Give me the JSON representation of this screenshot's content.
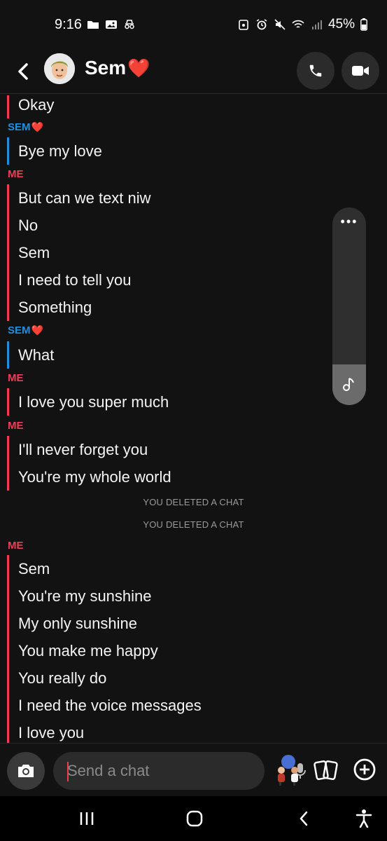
{
  "status_bar": {
    "time": "9:16",
    "battery": "45%",
    "left_icons": [
      "folder-icon",
      "image-icon",
      "incognito-icon"
    ],
    "right_icons": [
      "vpn-icon",
      "alarm-icon",
      "mute-icon",
      "wifi-icon",
      "signal-icon",
      "battery-icon"
    ]
  },
  "header": {
    "contact_name": "Sem",
    "name_emoji": "❤️",
    "actions": [
      "call-icon",
      "video-icon"
    ]
  },
  "chat": {
    "first_group": [
      "Okay"
    ],
    "blocks": [
      {
        "sender": "SEM",
        "sender_emoji": "❤️",
        "messages": [
          "Bye my love"
        ]
      },
      {
        "sender": "ME",
        "messages": [
          "But can we text niw",
          "No",
          "Sem",
          "I need to tell you",
          "Something"
        ]
      },
      {
        "sender": "SEM",
        "sender_emoji": "❤️",
        "messages": [
          "What"
        ]
      },
      {
        "sender": "ME",
        "messages": [
          "I love you super much"
        ]
      },
      {
        "sender": "ME",
        "messages": [
          "I'll never forget you",
          "You're my whole world"
        ]
      }
    ],
    "notices": [
      "YOU DELETED A CHAT",
      "YOU DELETED A CHAT"
    ],
    "last_block": {
      "sender": "ME",
      "messages": [
        "Sem",
        "You're my sunshine",
        "My only sunshine",
        "You make me happy",
        "You really do",
        "I need the voice messages",
        "I love you"
      ]
    }
  },
  "scroll_widget": {
    "menu": "•••"
  },
  "composer": {
    "placeholder": "Send a chat"
  },
  "colors": {
    "me": "#f23c57",
    "sem": "#1f8fe0",
    "background": "#121212"
  }
}
